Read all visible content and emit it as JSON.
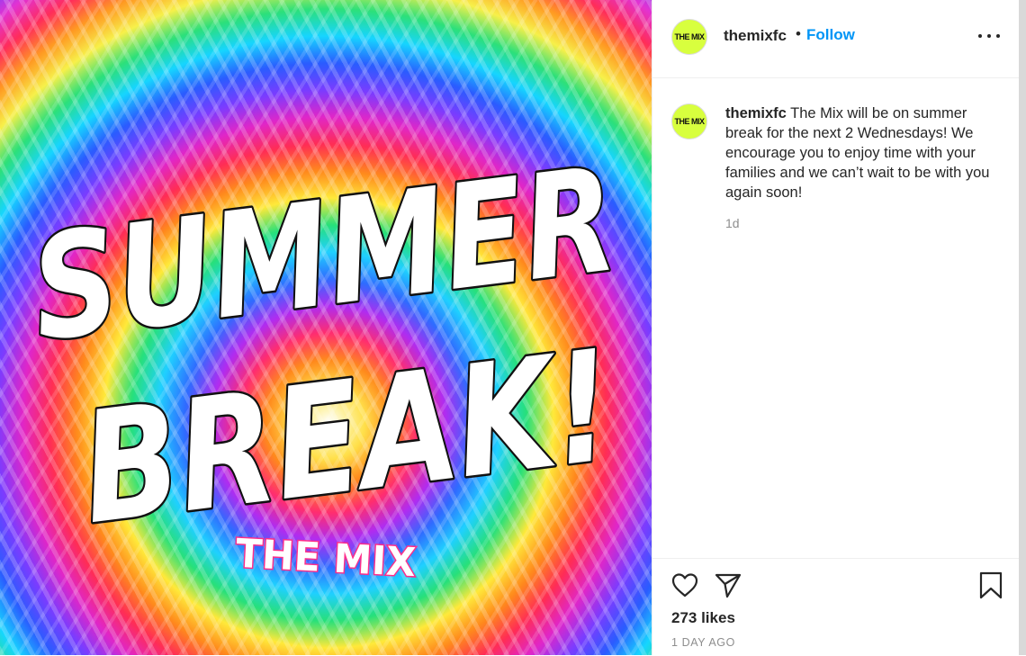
{
  "post": {
    "image": {
      "headline_line1": "SUMMER",
      "headline_line2": "BREAK!",
      "brand_text": "THE MIX"
    },
    "header": {
      "avatar_text": "THE MIX",
      "username": "themixfc",
      "separator": "•",
      "follow_label": "Follow",
      "more_icon": "ellipsis-icon"
    },
    "caption": {
      "avatar_text": "THE MIX",
      "username": "themixfc",
      "text": "The Mix will be on summer break for the next 2 Wednesdays! We encourage you to enjoy time with your families and we can’t wait to be with you again soon!",
      "time": "1d"
    },
    "actions": {
      "like_icon": "heart-icon",
      "share_icon": "send-icon",
      "save_icon": "bookmark-icon",
      "likes": "273 likes",
      "date": "1 DAY AGO"
    }
  },
  "colors": {
    "follow_blue": "#0095f6",
    "avatar_bg": "#d8ff3e",
    "muted_text": "#8e8e8e"
  }
}
